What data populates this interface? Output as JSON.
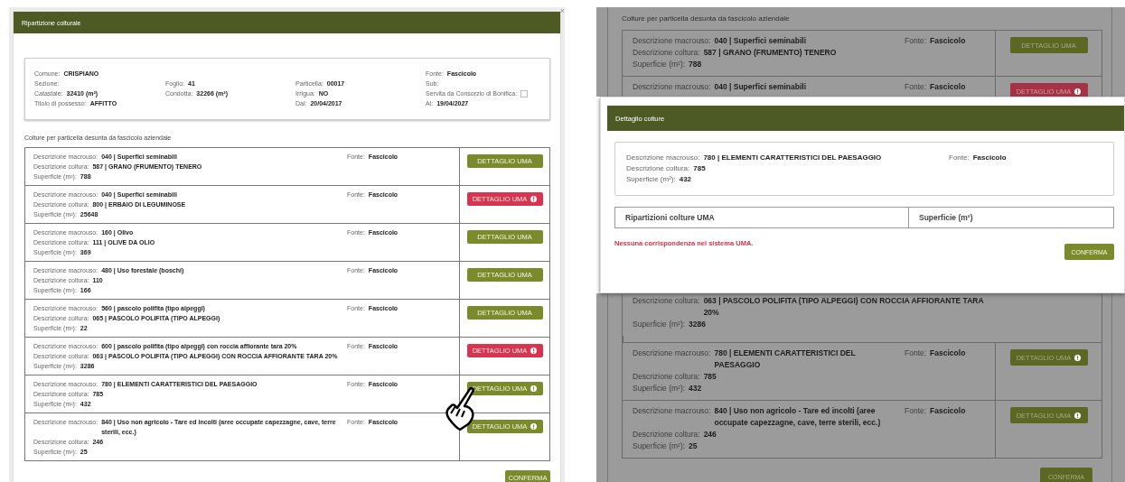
{
  "left": {
    "window_title": "Ripartizione colturale",
    "close": "×",
    "parcel_columns": [
      [
        {
          "label": "Comune:",
          "value": "CRISPIANO"
        },
        {
          "label": "Sezione:"
        },
        {
          "label": "Catastale:",
          "value": "32410 (m²)"
        },
        {
          "label": "Titolo di possesso:",
          "value": "AFFITTO"
        }
      ],
      [
        {
          "label": "Foglio:",
          "value": "41"
        },
        {
          "label": "Condotta:",
          "value": "32266 (m²)"
        }
      ],
      [
        {
          "label": "Particella:",
          "value": "00017"
        },
        {
          "label": "Irrigua:",
          "value": "NO"
        },
        {
          "label": "Dal:",
          "value": "20/04/2017"
        }
      ],
      [
        {
          "label": "Fonte:",
          "value": "Fascicolo"
        },
        {
          "label": "Sub:"
        },
        {
          "label": "Servita da Consorzio di Bonifica:",
          "kind": "checkbox",
          "checked": false
        },
        {
          "label": "Al:",
          "value": "19/04/2027"
        }
      ]
    ],
    "section_title": "Colture per particella desunta da fascicolo aziendale",
    "rows": [
      {
        "lines": [
          {
            "label": "Descrizione macrouso:",
            "value": "040 | Superfici seminabili"
          },
          {
            "label": "Descrizione coltura:",
            "value": "587 | GRANO (FRUMENTO) TENERO"
          },
          {
            "label": "Superficie (m²):",
            "value": "788"
          }
        ],
        "fonte": {
          "label": "Fonte:",
          "value": "Fascicolo"
        },
        "button": {
          "label": "DETTAGLIO UMA",
          "error": false,
          "info": false
        }
      },
      {
        "lines": [
          {
            "label": "Descrizione macrouso:",
            "value": "040 | Superfici seminabili"
          },
          {
            "label": "Descrizione coltura:",
            "value": "800 | ERBAIO DI LEGUMINOSE"
          },
          {
            "label": "Superficie (m²):",
            "value": "25648"
          }
        ],
        "fonte": {
          "label": "Fonte:",
          "value": "Fascicolo"
        },
        "button": {
          "label": "DETTAGLIO UMA",
          "error": true,
          "info": true
        }
      },
      {
        "lines": [
          {
            "label": "Descrizione macrouso:",
            "value": "160 | Olivo"
          },
          {
            "label": "Descrizione coltura:",
            "value": "111 | OLIVE DA OLIO"
          },
          {
            "label": "Superficie (m²):",
            "value": "369"
          }
        ],
        "fonte": {
          "label": "Fonte:",
          "value": "Fascicolo"
        },
        "button": {
          "label": "DETTAGLIO UMA",
          "error": false,
          "info": false
        }
      },
      {
        "lines": [
          {
            "label": "Descrizione macrouso:",
            "value": "480 | Uso forestale (boschi)"
          },
          {
            "label": "Descrizione coltura:",
            "value": "110"
          },
          {
            "label": "Superficie (m²):",
            "value": "166"
          }
        ],
        "fonte": {
          "label": "Fonte:",
          "value": "Fascicolo"
        },
        "button": {
          "label": "DETTAGLIO UMA",
          "error": false,
          "info": false
        }
      },
      {
        "lines": [
          {
            "label": "Descrizione macrouso:",
            "value": "560 | pascolo polifita (tipo alpeggi)"
          },
          {
            "label": "Descrizione coltura:",
            "value": "065 | PASCOLO POLIFITA (TIPO ALPEGGI)"
          },
          {
            "label": "Superficie (m²):",
            "value": "22"
          }
        ],
        "fonte": {
          "label": "Fonte:",
          "value": "Fascicolo"
        },
        "button": {
          "label": "DETTAGLIO UMA",
          "error": false,
          "info": false
        }
      },
      {
        "lines": [
          {
            "label": "Descrizione macrouso:",
            "value": "600 | pascolo polifita (tipo alpeggi) con roccia affiorante tara 20%"
          },
          {
            "label": "Descrizione coltura:",
            "value": "063 | PASCOLO POLIFITA (TIPO ALPEGGI) CON ROCCIA AFFIORANTE TARA 20%"
          },
          {
            "label": "Superficie (m²):",
            "value": "3286"
          }
        ],
        "fonte": {
          "label": "Fonte:",
          "value": "Fascicolo"
        },
        "button": {
          "label": "DETTAGLIO UMA",
          "error": true,
          "info": true
        }
      },
      {
        "lines": [
          {
            "label": "Descrizione macrouso:",
            "value": "780 | ELEMENTI CARATTERISTICI DEL PAESAGGIO"
          },
          {
            "label": "Descrizione coltura:",
            "value": "785"
          },
          {
            "label": "Superficie (m²):",
            "value": "432"
          }
        ],
        "fonte": {
          "label": "Fonte:",
          "value": "Fascicolo"
        },
        "button": {
          "label": "DETTAGLIO UMA",
          "error": false,
          "info": true
        }
      },
      {
        "lines": [
          {
            "label": "Descrizione macrouso:",
            "value": "840 | Uso non agricolo - Tare ed incolti (aree occupate capezzagne, cave, terre sterili, ecc.)"
          },
          {
            "label": "Descrizione coltura:",
            "value": "246"
          },
          {
            "label": "Superficie (m²):",
            "value": "25"
          }
        ],
        "fonte": {
          "label": "Fonte:",
          "value": "Fascicolo"
        },
        "button": {
          "label": "DETTAGLIO UMA",
          "error": false,
          "info": true
        }
      }
    ],
    "confirm": "CONFERMA"
  },
  "right": {
    "background": {
      "section_title": "Colture per particella desunta da fascicolo aziendale",
      "rows_top": [
        {
          "lines": [
            {
              "label": "Descrizione macrouso:",
              "value": "040 | Superfici seminabili"
            },
            {
              "label": "Descrizione coltura:",
              "value": "587 | GRANO (FRUMENTO) TENERO"
            },
            {
              "label": "Superficie (m²):",
              "value": "788"
            }
          ],
          "fonte": {
            "label": "Fonte:",
            "value": "Fascicolo"
          },
          "button": {
            "label": "DETTAGLIO UMA",
            "error": false,
            "info": false
          }
        },
        {
          "lines": [
            {
              "label": "Descrizione macrouso:",
              "value": "040 | Superfici seminabili"
            }
          ],
          "fonte": {
            "label": "Fonte:",
            "value": "Fascicolo"
          },
          "button": {
            "label": "DETTAGLIO UMA",
            "error": true,
            "info": true
          }
        }
      ],
      "rows_bottom": [
        {
          "lines": [
            {
              "label": "Descrizione coltura:",
              "value": "063 | PASCOLO POLIFITA (TIPO ALPEGGI) CON ROCCIA AFFIORANTE TARA 20%"
            },
            {
              "label": "Superficie (m²):",
              "value": "3286"
            }
          ]
        },
        {
          "lines": [
            {
              "label": "Descrizione macrouso:",
              "value": "780 | ELEMENTI CARATTERISTICI DEL PAESAGGIO"
            },
            {
              "label": "Descrizione coltura:",
              "value": "785"
            },
            {
              "label": "Superficie (m²):",
              "value": "432"
            }
          ],
          "fonte": {
            "label": "Fonte:",
            "value": "Fascicolo"
          },
          "button": {
            "label": "DETTAGLIO UMA",
            "error": false,
            "info": true
          }
        },
        {
          "lines": [
            {
              "label": "Descrizione macrouso:",
              "value": "840 | Uso non agricolo - Tare ed incolti (aree occupate capezzagne, cave, terre sterili, ecc.)"
            },
            {
              "label": "Descrizione coltura:",
              "value": "246"
            },
            {
              "label": "Superficie (m²):",
              "value": "25"
            }
          ],
          "fonte": {
            "label": "Fonte:",
            "value": "Fascicolo"
          },
          "button": {
            "label": "DETTAGLIO UMA",
            "error": false,
            "info": true
          }
        }
      ],
      "confirm": "CONFERMA"
    },
    "modal": {
      "title": "Dettaglio colture",
      "lines": [
        {
          "label": "Descrizione macrouso:",
          "value": "780 | ELEMENTI CARATTERISTICI DEL PAESAGGIO"
        },
        {
          "label": "Descrizione coltura:",
          "value": "785"
        },
        {
          "label": "Superficie (m²):",
          "value": "432"
        }
      ],
      "fonte": {
        "label": "Fonte:",
        "value": "Fascicolo"
      },
      "columns": [
        "Ripartizioni colture UMA",
        "Superficie (m²)"
      ],
      "message": "Nessuna corrispondenza nel sistema UMA.",
      "confirm": "CONFERMA"
    }
  }
}
